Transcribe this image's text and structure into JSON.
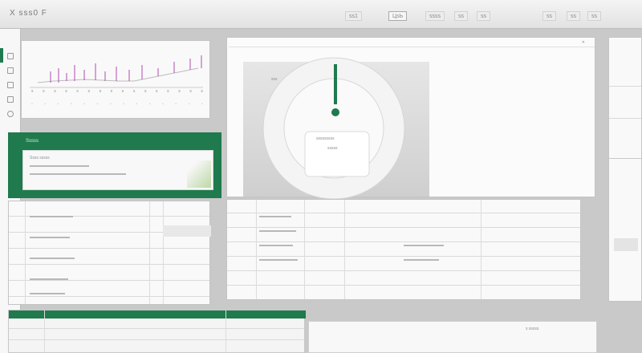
{
  "titlebar": {
    "title": "X ѕѕѕ0 F",
    "tabs": [
      "ѕѕ1",
      "ЦѕЬ",
      "ѕѕѕѕ",
      "ѕѕ"
    ],
    "right_buttons": [
      "ѕѕ",
      "ѕѕ",
      "ѕѕ",
      "ѕѕ"
    ]
  },
  "top_panel": {
    "axis_labels": [
      "ѕ",
      "ѕ",
      "ѕ",
      "ѕ",
      "ѕ",
      "ѕ",
      "ѕ",
      "ѕ",
      "ѕ",
      "ѕ",
      "ѕ",
      "ѕ",
      "ѕ",
      "ѕ",
      "ѕ",
      "ѕ"
    ]
  },
  "green_panel": {
    "title": "Ѕѕѕѕѕ",
    "subtitle": "Ѕѕѕѕ ѕѕѕѕѕ"
  },
  "dialog": {
    "title": "ѕѕѕ",
    "line": "ѕѕѕѕѕѕѕѕѕ",
    "caption": "ѕѕѕѕѕ"
  },
  "bottom_panel": {
    "label": "ѕ ѕѕѕѕѕ"
  },
  "colors": {
    "accent": "#1f7a4d",
    "chart_magenta": "#b04ab0",
    "panel": "#f9f9f9"
  }
}
